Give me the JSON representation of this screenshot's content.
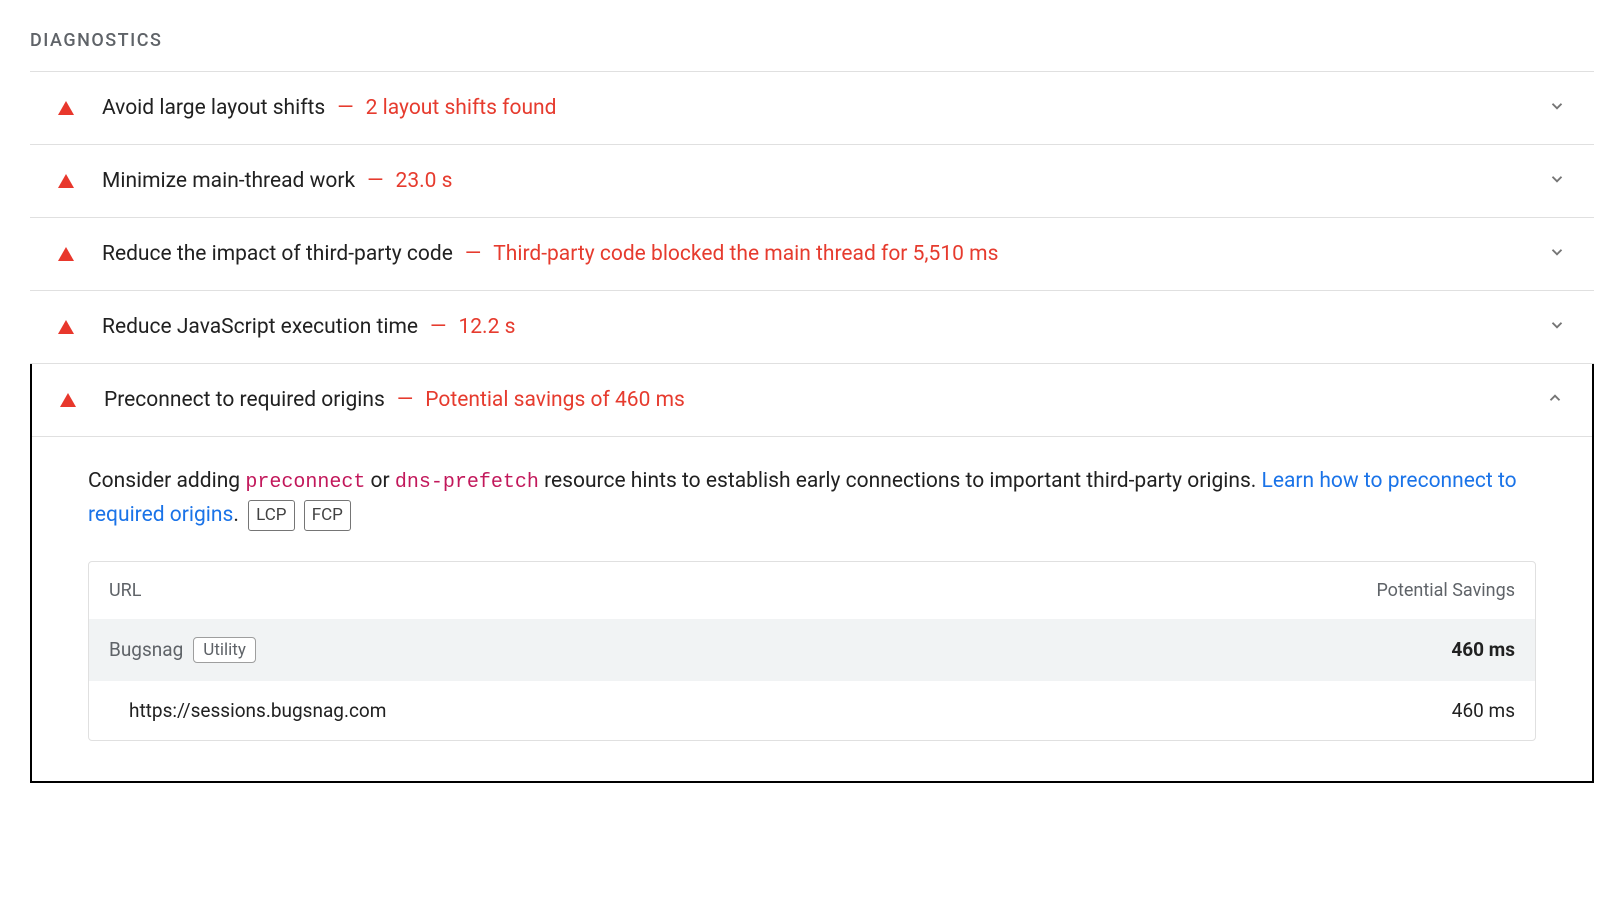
{
  "section_title": "DIAGNOSTICS",
  "audits": [
    {
      "title": "Avoid large layout shifts",
      "detail": "2 layout shifts found",
      "expanded": false
    },
    {
      "title": "Minimize main-thread work",
      "detail": "23.0 s",
      "expanded": false
    },
    {
      "title": "Reduce the impact of third-party code",
      "detail": "Third-party code blocked the main thread for 5,510 ms",
      "expanded": false
    },
    {
      "title": "Reduce JavaScript execution time",
      "detail": "12.2 s",
      "expanded": false
    },
    {
      "title": "Preconnect to required origins",
      "detail": "Potential savings of 460 ms",
      "expanded": true
    }
  ],
  "expanded_audit": {
    "description_prefix": "Consider adding ",
    "code1": "preconnect",
    "description_or": " or ",
    "code2": "dns-prefetch",
    "description_suffix": " resource hints to establish early connections to important third-party origins. ",
    "learn_more": "Learn how to preconnect to required origins",
    "period": ".",
    "badges": [
      "LCP",
      "FCP"
    ],
    "table": {
      "header_url": "URL",
      "header_savings": "Potential Savings",
      "group": {
        "name": "Bugsnag",
        "badge": "Utility",
        "value": "460 ms"
      },
      "items": [
        {
          "url": "https://sessions.bugsnag.com",
          "savings": "460 ms"
        }
      ]
    }
  }
}
